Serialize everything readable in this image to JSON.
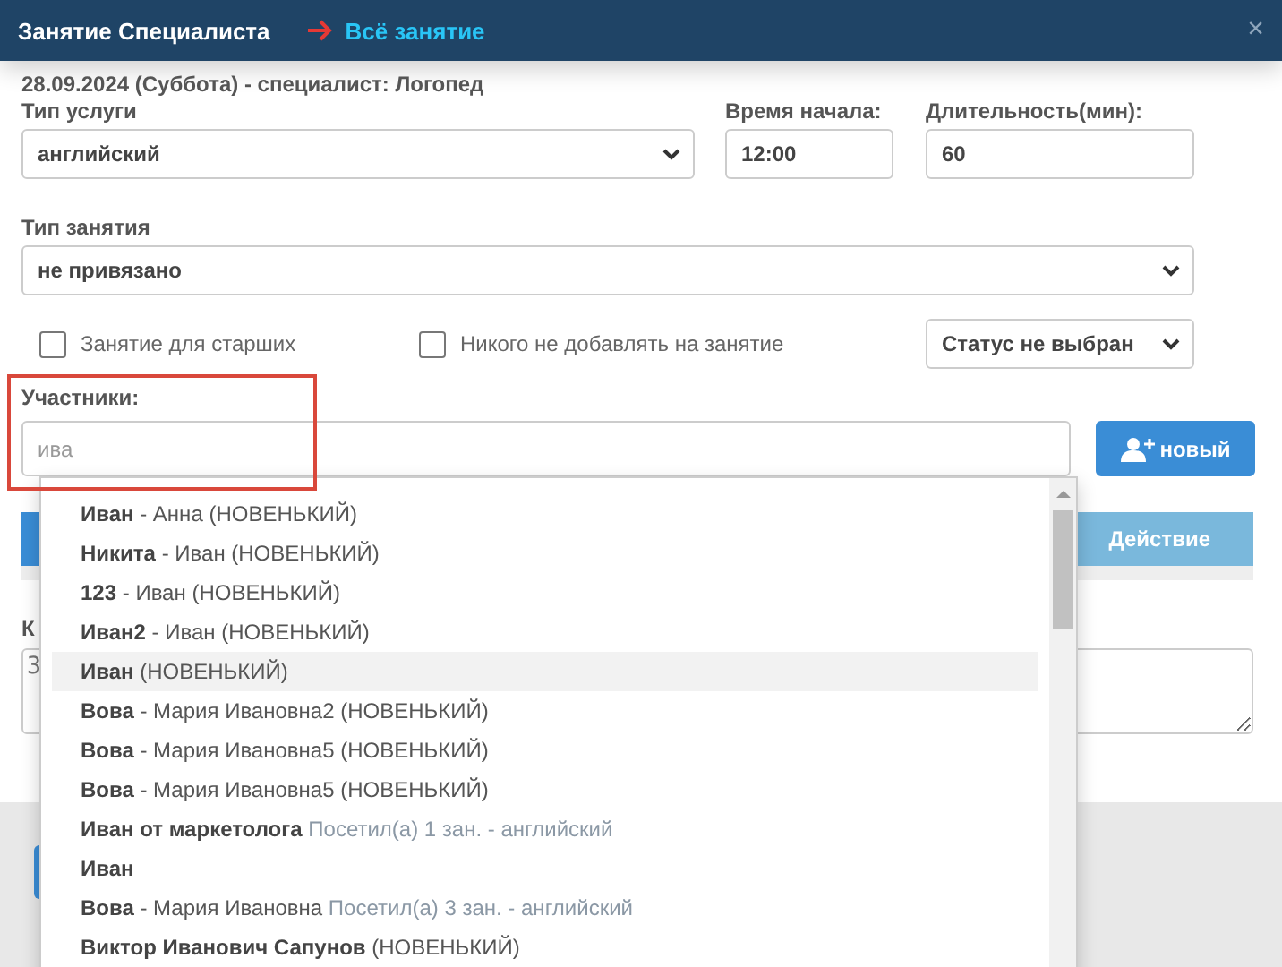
{
  "window": {
    "title": "Занятие Специалиста",
    "link": "Всё занятие",
    "close": "×"
  },
  "info": "28.09.2024 (Суббота) - специалист: Логопед",
  "service": {
    "label": "Тип услуги",
    "value": "английский"
  },
  "start_time": {
    "label": "Время начала:",
    "value": "12:00"
  },
  "duration": {
    "label": "Длительность(мин):",
    "value": "60"
  },
  "lesson_type": {
    "label": "Тип занятия",
    "value": "не привязано"
  },
  "checkboxes": [
    {
      "label": "Занятие для старших",
      "checked": false
    },
    {
      "label": "Никого не добавлять на занятие",
      "checked": false
    }
  ],
  "status": {
    "value": "Статус не выбран"
  },
  "participants": {
    "label": "Участники:",
    "placeholder": "ива",
    "new_button": "новый"
  },
  "table": {
    "columns": [
      "Действие"
    ]
  },
  "comment": {
    "label": "К",
    "placeholder": "З"
  },
  "suggestions": [
    {
      "name": "Иван",
      "detail": "- Анна (НОВЕНЬКИЙ)",
      "selected": false
    },
    {
      "name": "Никита",
      "detail": "- Иван (НОВЕНЬКИЙ)",
      "selected": false
    },
    {
      "name": "123",
      "detail": "- Иван (НОВЕНЬКИЙ)",
      "selected": false
    },
    {
      "name": "Иван2",
      "detail": "- Иван (НОВЕНЬКИЙ)",
      "selected": false
    },
    {
      "name": "Иван",
      "detail": "(НОВЕНЬКИЙ)",
      "selected": true
    },
    {
      "name": "Вова",
      "detail": "- Мария Ивановна2 (НОВЕНЬКИЙ)",
      "selected": false
    },
    {
      "name": "Вова",
      "detail": "- Мария Ивановна5 (НОВЕНЬКИЙ)",
      "selected": false
    },
    {
      "name": "Вова",
      "detail": "- Мария Ивановна5 (НОВЕНЬКИЙ)",
      "selected": false
    },
    {
      "name": "Иван от маркетолога",
      "note": "Посетил(а) 1 зан. - английский",
      "selected": false
    },
    {
      "name": "Иван",
      "selected": false
    },
    {
      "name": "Вова",
      "detail": "- Мария Ивановна",
      "note": "Посетил(а) 3 зан. - английский",
      "selected": false
    },
    {
      "name": "Виктор Иванович Сапунов",
      "detail": "(НОВЕНЬКИЙ)",
      "selected": false
    }
  ]
}
